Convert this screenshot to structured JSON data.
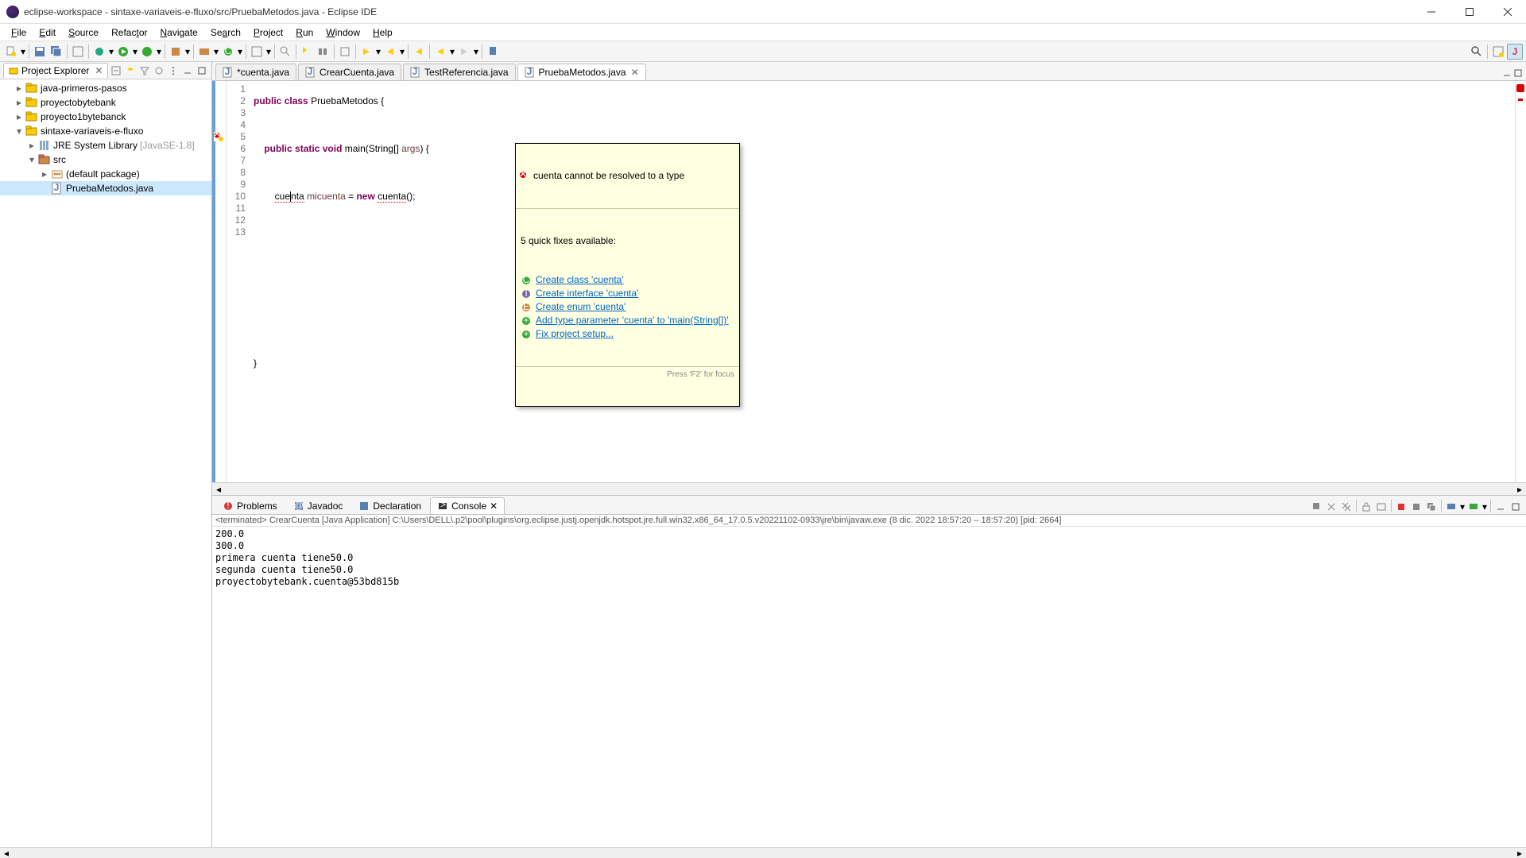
{
  "window": {
    "title": "eclipse-workspace - sintaxe-variaveis-e-fluxo/src/PruebaMetodos.java - Eclipse IDE"
  },
  "menu": [
    "File",
    "Edit",
    "Source",
    "Refactor",
    "Navigate",
    "Search",
    "Project",
    "Run",
    "Window",
    "Help"
  ],
  "explorer": {
    "title": "Project Explorer",
    "items": [
      {
        "label": "java-primeros-pasos",
        "indent": 1,
        "expander": "▸",
        "icon": "proj"
      },
      {
        "label": "proyectobytebank",
        "indent": 1,
        "expander": "▸",
        "icon": "proj"
      },
      {
        "label": "proyecto1bytebanck",
        "indent": 1,
        "expander": "▸",
        "icon": "proj"
      },
      {
        "label": "sintaxe-variaveis-e-fluxo",
        "indent": 1,
        "expander": "▾",
        "icon": "proj"
      },
      {
        "label": "JRE System Library",
        "lib": "[JavaSE-1.8]",
        "indent": 2,
        "expander": "▸",
        "icon": "lib"
      },
      {
        "label": "src",
        "indent": 2,
        "expander": "▾",
        "icon": "pkg"
      },
      {
        "label": "(default package)",
        "indent": 3,
        "expander": "▸",
        "icon": "pkgf"
      },
      {
        "label": "PruebaMetodos.java",
        "indent": 3,
        "expander": "",
        "icon": "java",
        "selected": true
      }
    ]
  },
  "editor_tabs": [
    {
      "label": "*cuenta.java",
      "active": false,
      "close": false
    },
    {
      "label": "CrearCuenta.java",
      "active": false,
      "close": false
    },
    {
      "label": "TestReferencia.java",
      "active": false,
      "close": false
    },
    {
      "label": "PruebaMetodos.java",
      "active": true,
      "close": true
    }
  ],
  "code": {
    "line1": {
      "kw1": "public",
      "kw2": "class",
      "cls": "PruebaMetodos",
      "brace": " {"
    },
    "line3": {
      "kw1": "public",
      "kw2": "static",
      "kw3": "void",
      "m": "main",
      "p1": "(String[] ",
      "arg": "args",
      "p2": ") {"
    },
    "line5": {
      "t1": "cue",
      "t1b": "nta",
      "sp": " ",
      "v": "micuenta",
      "eq": " = ",
      "kw": "new",
      "sp2": " ",
      "t2": "cuenta",
      "paren": "();"
    },
    "line12": "}",
    "linenums": [
      "1",
      "2",
      "3",
      "4",
      "5",
      "6",
      "7",
      "8",
      "9",
      "10",
      "11",
      "12",
      "13"
    ]
  },
  "tooltip": {
    "error": "cuenta cannot be resolved to a type",
    "sub": "5 quick fixes available:",
    "fixes": [
      {
        "label": "Create class 'cuenta'",
        "icon": "class"
      },
      {
        "label": "Create interface 'cuenta'",
        "icon": "interface"
      },
      {
        "label": "Create enum 'cuenta'",
        "icon": "enum"
      },
      {
        "label": "Add type parameter 'cuenta' to 'main(String[])'",
        "icon": "add"
      },
      {
        "label": "Fix project setup...",
        "icon": "fix"
      }
    ],
    "footer": "Press 'F2' for focus"
  },
  "bottom_tabs": [
    {
      "label": "Problems",
      "icon": "prob"
    },
    {
      "label": "Javadoc",
      "icon": "jdoc"
    },
    {
      "label": "Declaration",
      "icon": "decl"
    },
    {
      "label": "Console",
      "icon": "cons",
      "active": true,
      "close": true
    }
  ],
  "console": {
    "meta": "<terminated> CrearCuenta [Java Application] C:\\Users\\DELL\\.p2\\pool\\plugins\\org.eclipse.justj.openjdk.hotspot.jre.full.win32.x86_64_17.0.5.v20221102-0933\\jre\\bin\\javaw.exe  (8 dic. 2022 18:57:20 – 18:57:20) [pid: 2664]",
    "out": "200.0\n300.0\nprimera cuenta tiene50.0\nsegunda cuenta tiene50.0\nproyectobytebank.cuenta@53bd815b"
  }
}
